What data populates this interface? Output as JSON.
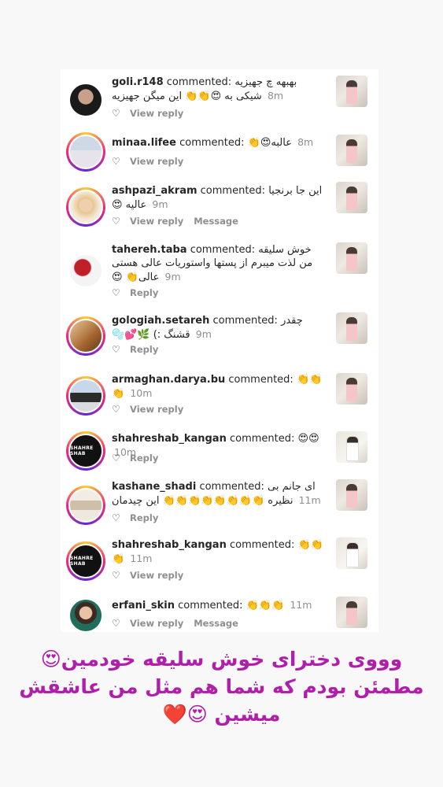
{
  "comments": [
    {
      "username": "goli.r148",
      "verb": "commented:",
      "body": "بهبهه چ جهیزیه شیکی به 😍👏👏 این میگن جهیزیه",
      "time": "8m",
      "actions": [
        "View reply"
      ]
    },
    {
      "username": "minaa.lifee",
      "verb": "commented:",
      "body": "عالبه😍👏",
      "time": "8m",
      "actions": [
        "View reply"
      ]
    },
    {
      "username": "ashpazi_akram",
      "verb": "commented:",
      "body": "این جا برنجیا عالیه 😍",
      "time": "9m",
      "actions": [
        "View reply",
        "Message"
      ]
    },
    {
      "username": "tahereh.taba",
      "verb": "commented:",
      "body": "خوش سلیقه من لذت میبرم از پستها واستوریات عالی هستی عالی👏 😍",
      "time": "9m",
      "actions": [
        "Reply"
      ]
    },
    {
      "username": "gologiah.setareh",
      "verb": "commented:",
      "body": "چقدر قشنگ :) 🌿💕🫧",
      "time": "9m",
      "actions": [
        "Reply"
      ]
    },
    {
      "username": "armaghan.darya.bu",
      "verb": "commented:",
      "body": "👏👏👏",
      "time": "10m",
      "actions": [
        "View reply"
      ]
    },
    {
      "username": "shahreshab_kangan",
      "verb": "commented:",
      "body": "😍😍",
      "time": "10m",
      "actions": [
        "Reply"
      ]
    },
    {
      "username": "kashane_shadi",
      "verb": "commented:",
      "body": "ای جانم بی نظیره 👏👏👏👏👏👏👏👏 این چیدمان",
      "time": "11m",
      "actions": [
        "Reply"
      ]
    },
    {
      "username": "shahreshab_kangan",
      "verb": "commented:",
      "body": "👏👏👏",
      "time": "11m",
      "actions": [
        "View reply"
      ]
    },
    {
      "username": "erfani_skin",
      "verb": "commented:",
      "body": "👏👏👏",
      "time": "11m",
      "actions": [
        "View reply",
        "Message"
      ]
    }
  ],
  "avatar_text": {
    "shahreshab": "SHAHRE SHAB"
  },
  "caption": {
    "line1": "وووی دخترای خوش سلیقه خودمین😍",
    "line2": "مطمئن بودم که شما هم مثل من عاشقش",
    "line3": "میشین 😍❤️"
  },
  "icons": {
    "like": "heart-outline-icon"
  },
  "colors": {
    "caption": "#b01faa",
    "muted": "#8e8e8e",
    "text": "#262626"
  }
}
